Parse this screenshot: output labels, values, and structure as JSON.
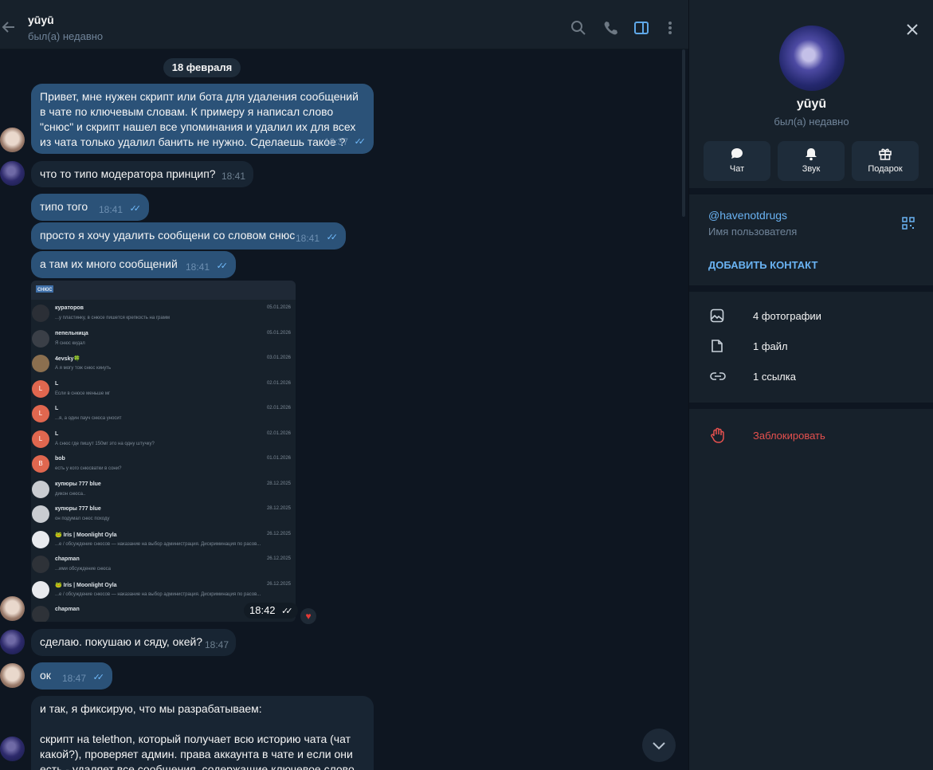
{
  "header": {
    "name": "yūyū",
    "status": "был(а) недавно"
  },
  "date_chip": "18 февраля",
  "messages": [
    {
      "text": "Привет, мне нужен скрипт или бота для удаления сообщений в чате по ключевым словам. К примеру я написал слово \"снюс\" и скрипт нашел все упоминания и удалил их для всех из чата только удалил банить не нужно.  Сделаешь такое ?",
      "time": "18:37"
    },
    {
      "text": "что то типо модератора принцип?",
      "time": "18:41"
    },
    {
      "text": "типо того",
      "time": "18:41"
    },
    {
      "text": "просто я хочу удалить сообщени со словом снюс",
      "time": "18:41"
    },
    {
      "text": "а там их много сообщений",
      "time": "18:41"
    },
    {
      "text": "сделаю. покушаю и сяду, окей?",
      "time": "18:47"
    },
    {
      "text": "ок",
      "time": "18:47"
    },
    {
      "text": "и так, я фиксирую, что мы разрабатываем:",
      "text2": "скрипт на telethon, который получает всю историю чата (чат какой?), проверяет админ. права аккаунта в чате и если они есть - удаляет все сообщения, содержащие ключевое слово"
    }
  ],
  "ticks": "✓✓",
  "reaction": "♥",
  "photo": {
    "time": "18:42",
    "search_text": "снюс",
    "rows": [
      {
        "name": "кураторов",
        "preview": "...у пластинку, в снюсе пишется крепкость на грамм",
        "date": "05.01.2026",
        "letter": "",
        "color": "#2b2f36"
      },
      {
        "name": "пепельница",
        "preview": "Я снюс кидал",
        "date": "05.01.2026",
        "letter": "",
        "color": "#3a3f47"
      },
      {
        "name": "4evsky🍀",
        "preview": "А я могу тож снюс кинуть",
        "date": "03.01.2026",
        "letter": "",
        "color": "#8b6f4f"
      },
      {
        "name": "L",
        "preview": "Если в снюсе меньше мг",
        "date": "02.01.2026",
        "letter": "L",
        "color": "#e0674f"
      },
      {
        "name": "L",
        "preview": "...я, а один пауч снюса уносит",
        "date": "02.01.2026",
        "letter": "L",
        "color": "#e0674f"
      },
      {
        "name": "L",
        "preview": "А снюс где пишут 150мг это на одну штучку?",
        "date": "02.01.2026",
        "letter": "L",
        "color": "#e0674f"
      },
      {
        "name": "bob",
        "preview": "есть у кого снюсватки в сони?",
        "date": "01.01.2026",
        "letter": "B",
        "color": "#e0674f"
      },
      {
        "name": "купюры 777 blue",
        "preview": "дикон снюса..",
        "date": "28.12.2025",
        "letter": "",
        "color": "#c9ccd1"
      },
      {
        "name": "купюры 777 blue",
        "preview": "он подумал снюс походу",
        "date": "28.12.2025",
        "letter": "",
        "color": "#c9ccd1"
      },
      {
        "name": "🐸 Iris | Moonlight Oyla",
        "preview": "...е / обсуждение снюсов — наказание на выбор администрация. Дискриминация по расов...",
        "date": "26.12.2025",
        "letter": "",
        "color": "#e8eaee"
      },
      {
        "name": "chapman",
        "preview": "...ими обсуждение снюса",
        "date": "26.12.2025",
        "letter": "",
        "color": "#2e3238"
      },
      {
        "name": "🐸 Iris | Moonlight Oyla",
        "preview": "...е / обсуждение снюсов — наказание на выбор администрация. Дискриминация по расов...",
        "date": "26.12.2025",
        "letter": "",
        "color": "#e8eaee"
      },
      {
        "name": "chapman",
        "preview": "",
        "date": "26.12.2025",
        "letter": "",
        "color": "#2e3238"
      }
    ]
  },
  "panel": {
    "name": "yūyū",
    "status": "был(а) недавно",
    "buttons": [
      {
        "label": "Чат",
        "icon": "chat-icon"
      },
      {
        "label": "Звук",
        "icon": "bell-icon"
      },
      {
        "label": "Подарок",
        "icon": "gift-icon"
      }
    ],
    "username": "@havenotdrugs",
    "username_label": "Имя пользователя",
    "add_contact": "ДОБАВИТЬ КОНТАКТ",
    "media": [
      {
        "label": "4 фотографии",
        "icon": "photo-icon"
      },
      {
        "label": "1 файл",
        "icon": "file-icon"
      },
      {
        "label": "1 ссылка",
        "icon": "link-icon"
      }
    ],
    "block": "Заблокировать"
  },
  "colors": {
    "outgoing_bubble": "#2b5278",
    "incoming_bubble": "#182533",
    "accent": "#6ab3f3",
    "danger": "#e5504e"
  }
}
